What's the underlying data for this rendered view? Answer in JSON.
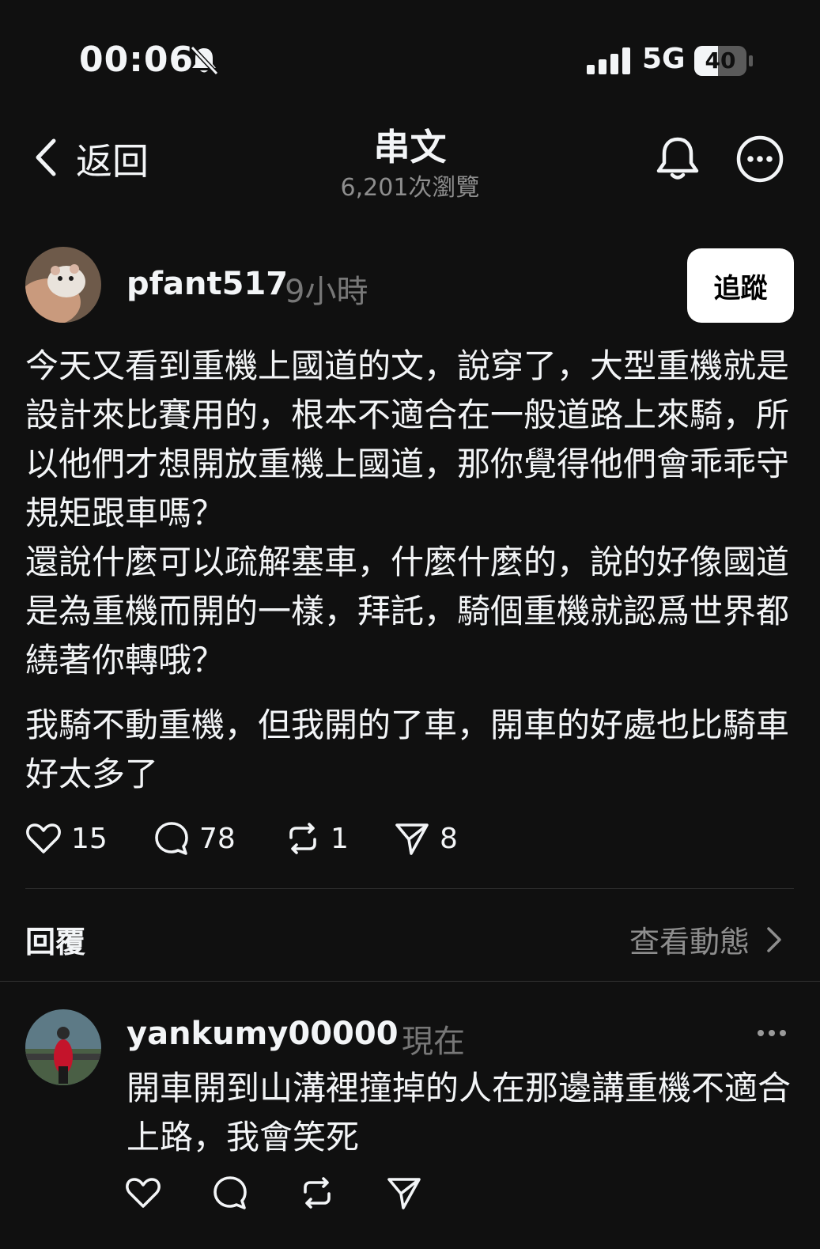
{
  "status_bar": {
    "time": "00:06",
    "network": "5G",
    "battery": "40"
  },
  "header": {
    "back_label": "返回",
    "title": "串文",
    "views": "6,201次瀏覽"
  },
  "post": {
    "author": "pfant517",
    "time": "9小時",
    "follow_label": "追蹤",
    "paragraphs": [
      "今天又看到重機上國道的文，說穿了，大型重機就是設計來比賽用的，根本不適合在一般道路上來騎，所以他們才想開放重機上國道，那你覺得他們會乖乖守規矩跟車嗎？",
      "還說什麼可以疏解塞車，什麼什麼的，說的好像國道是為重機而開的一樣，拜託，騎個重機就認爲世界都繞著你轉哦？",
      "我騎不動重機，但我開的了車，開車的好處也比騎車好太多了"
    ],
    "likes": "15",
    "comments": "78",
    "reposts": "1",
    "shares": "8"
  },
  "replies_section": {
    "label": "回覆",
    "activity_label": "查看動態"
  },
  "reply": {
    "author": "yankumy00000",
    "time": "現在",
    "text": "開車開到山溝裡撞掉的人在那邊講重機不適合上路，我會笑死"
  }
}
